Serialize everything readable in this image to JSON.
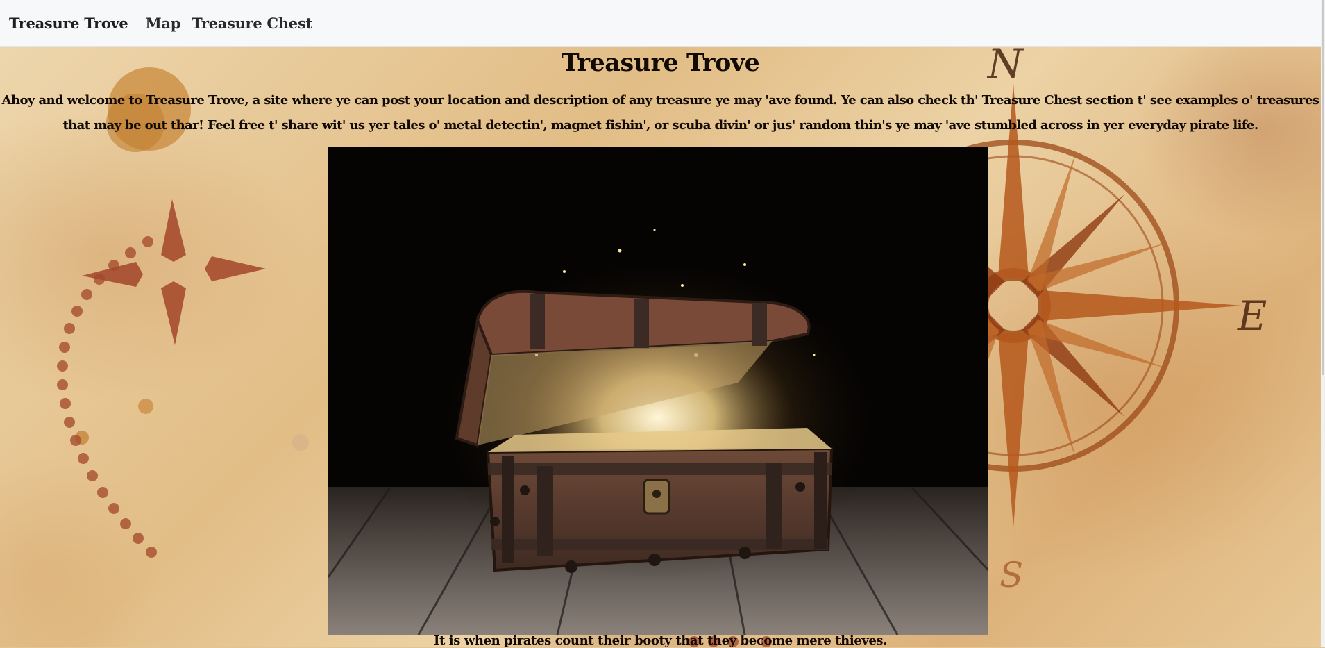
{
  "navbar": {
    "brand": "Treasure Trove",
    "links": [
      {
        "label": "Map"
      },
      {
        "label": "Treasure Chest"
      }
    ]
  },
  "page": {
    "title": "Treasure Trove",
    "intro": "Ahoy and welcome to Treasure Trove, a site where ye can post your location and description of any treasure ye may 'ave found. Ye can also check th' Treasure Chest section t' see examples o' treasures that may be out thar! Feel free t' share wit' us yer tales o' metal detectin', magnet fishin', or scuba divin' or jus' random thin's ye may 'ave stumbled across in yer everyday pirate life.",
    "caption": "It is when pirates count their booty that they become mere thieves."
  },
  "compass": {
    "north_letter": "N",
    "east_letter": "E",
    "south_letter": "S"
  },
  "colors": {
    "parchment": "#e3c392",
    "ink": "#120a04",
    "map_red": "#a3472a",
    "compass": "#9c4a18"
  }
}
